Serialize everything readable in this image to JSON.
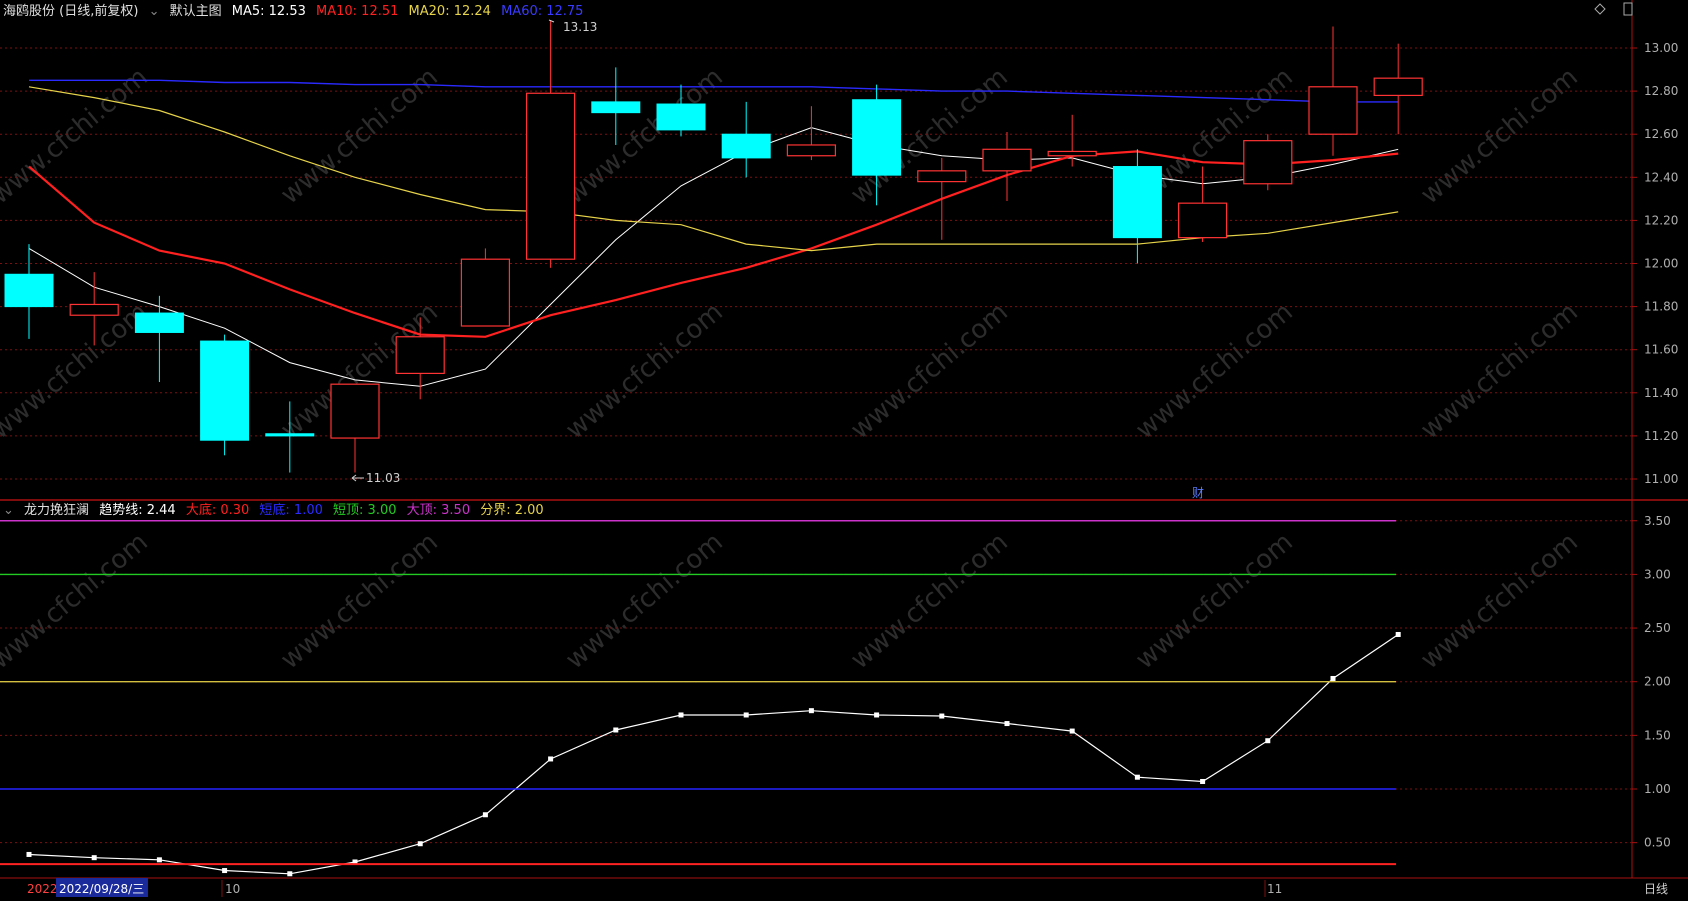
{
  "main_header": {
    "stock_label": "海鸥股份 (日线,前复权)",
    "template_label": "默认主图",
    "ma5": "MA5: 12.53",
    "ma10": "MA10: 12.51",
    "ma20": "MA20: 12.24",
    "ma60": "MA60: 12.75"
  },
  "sub_header": {
    "indicator_name": "龙力挽狂澜",
    "trend": "趋势线: 2.44",
    "big_bottom": "大底: 0.30",
    "short_bottom": "短底: 1.00",
    "short_top": "短顶: 3.00",
    "big_top": "大顶: 3.50",
    "boundary": "分界: 2.00"
  },
  "footer": {
    "year_label": "2022",
    "cursor_date": "2022/09/28/三",
    "month_oct": "10",
    "month_nov": "11",
    "period_button": "日线"
  },
  "annotations": {
    "high": "13.13",
    "low": "11.03",
    "finance_marker": "财"
  },
  "colors": {
    "up": "#ff3333",
    "down": "#00ffff",
    "ma5": "#ffffff",
    "ma10": "#ff2020",
    "ma20": "#e6d34a",
    "ma60": "#2a2aff",
    "grid": "#7a1010",
    "big_top": "#cc33cc",
    "short_top": "#22cc22",
    "boundary": "#d4c040",
    "short_bottom": "#2222ff",
    "big_bottom": "#ff2222",
    "trend": "#ffffff"
  },
  "chart_data": [
    {
      "type": "candlestick",
      "title": "海鸥股份 (日线,前复权)",
      "y_ticks": [
        "11.00",
        "11.20",
        "11.40",
        "11.60",
        "11.80",
        "12.00",
        "12.20",
        "12.40",
        "12.60",
        "12.80",
        "13.00"
      ],
      "ylim": [
        10.95,
        13.2
      ],
      "candles": [
        {
          "o": 11.95,
          "h": 12.09,
          "l": 11.65,
          "c": 11.8
        },
        {
          "o": 11.76,
          "h": 11.96,
          "l": 11.62,
          "c": 11.81
        },
        {
          "o": 11.77,
          "h": 11.85,
          "l": 11.45,
          "c": 11.68
        },
        {
          "o": 11.64,
          "h": 11.67,
          "l": 11.11,
          "c": 11.18
        },
        {
          "o": 11.21,
          "h": 11.36,
          "l": 11.03,
          "c": 11.2
        },
        {
          "o": 11.19,
          "h": 11.44,
          "l": 11.03,
          "c": 11.44
        },
        {
          "o": 11.49,
          "h": 11.75,
          "l": 11.37,
          "c": 11.66
        },
        {
          "o": 11.71,
          "h": 12.07,
          "l": 11.71,
          "c": 12.02
        },
        {
          "o": 12.02,
          "h": 13.13,
          "l": 11.98,
          "c": 12.79
        },
        {
          "o": 12.75,
          "h": 12.91,
          "l": 12.55,
          "c": 12.7
        },
        {
          "o": 12.74,
          "h": 12.83,
          "l": 12.59,
          "c": 12.62
        },
        {
          "o": 12.6,
          "h": 12.75,
          "l": 12.4,
          "c": 12.49
        },
        {
          "o": 12.5,
          "h": 12.73,
          "l": 12.48,
          "c": 12.55
        },
        {
          "o": 12.76,
          "h": 12.83,
          "l": 12.27,
          "c": 12.41
        },
        {
          "o": 12.38,
          "h": 12.49,
          "l": 12.11,
          "c": 12.43
        },
        {
          "o": 12.43,
          "h": 12.61,
          "l": 12.29,
          "c": 12.53
        },
        {
          "o": 12.5,
          "h": 12.69,
          "l": 12.45,
          "c": 12.52
        },
        {
          "o": 12.45,
          "h": 12.53,
          "l": 12.0,
          "c": 12.12
        },
        {
          "o": 12.12,
          "h": 12.45,
          "l": 12.1,
          "c": 12.28
        },
        {
          "o": 12.37,
          "h": 12.6,
          "l": 12.34,
          "c": 12.57
        },
        {
          "o": 12.6,
          "h": 13.1,
          "l": 12.5,
          "c": 12.82
        },
        {
          "o": 12.78,
          "h": 13.02,
          "l": 12.6,
          "c": 12.86
        }
      ],
      "series": [
        {
          "name": "MA5",
          "values": [
            12.07,
            11.89,
            11.8,
            11.7,
            11.54,
            11.46,
            11.43,
            11.51,
            11.81,
            12.11,
            12.36,
            12.52,
            12.63,
            12.55,
            12.5,
            12.48,
            12.49,
            12.41,
            12.37,
            12.4,
            12.46,
            12.53
          ]
        },
        {
          "name": "MA10",
          "values": [
            12.45,
            12.19,
            12.06,
            12.0,
            11.88,
            11.77,
            11.67,
            11.66,
            11.76,
            11.83,
            11.91,
            11.98,
            12.07,
            12.18,
            12.3,
            12.41,
            12.5,
            12.52,
            12.47,
            12.46,
            12.48,
            12.51
          ]
        },
        {
          "name": "MA20",
          "values": [
            12.82,
            12.77,
            12.71,
            12.61,
            12.5,
            12.4,
            12.32,
            12.25,
            12.24,
            12.2,
            12.18,
            12.09,
            12.06,
            12.09,
            12.09,
            12.09,
            12.09,
            12.09,
            12.12,
            12.14,
            12.19,
            12.24
          ]
        },
        {
          "name": "MA60",
          "values": [
            12.85,
            12.85,
            12.85,
            12.84,
            12.84,
            12.83,
            12.83,
            12.82,
            12.82,
            12.82,
            12.82,
            12.82,
            12.82,
            12.81,
            12.8,
            12.8,
            12.79,
            12.78,
            12.77,
            12.76,
            12.75,
            12.75
          ]
        }
      ]
    },
    {
      "type": "line",
      "title": "龙力挽狂澜",
      "y_ticks": [
        "0.50",
        "1.00",
        "1.50",
        "2.00",
        "2.50",
        "3.00",
        "3.50"
      ],
      "ylim": [
        0.2,
        3.6
      ],
      "series": [
        {
          "name": "趋势线",
          "values": [
            0.39,
            0.36,
            0.34,
            0.24,
            0.21,
            0.32,
            0.49,
            0.76,
            1.28,
            1.55,
            1.69,
            1.69,
            1.73,
            1.69,
            1.68,
            1.61,
            1.54,
            1.11,
            1.07,
            1.45,
            2.03,
            2.44
          ]
        },
        {
          "name": "大顶",
          "values": [
            3.5
          ]
        },
        {
          "name": "短顶",
          "values": [
            3.0
          ]
        },
        {
          "name": "分界",
          "values": [
            2.0
          ]
        },
        {
          "name": "短底",
          "values": [
            1.0
          ]
        },
        {
          "name": "大底",
          "values": [
            0.3
          ]
        }
      ]
    }
  ]
}
